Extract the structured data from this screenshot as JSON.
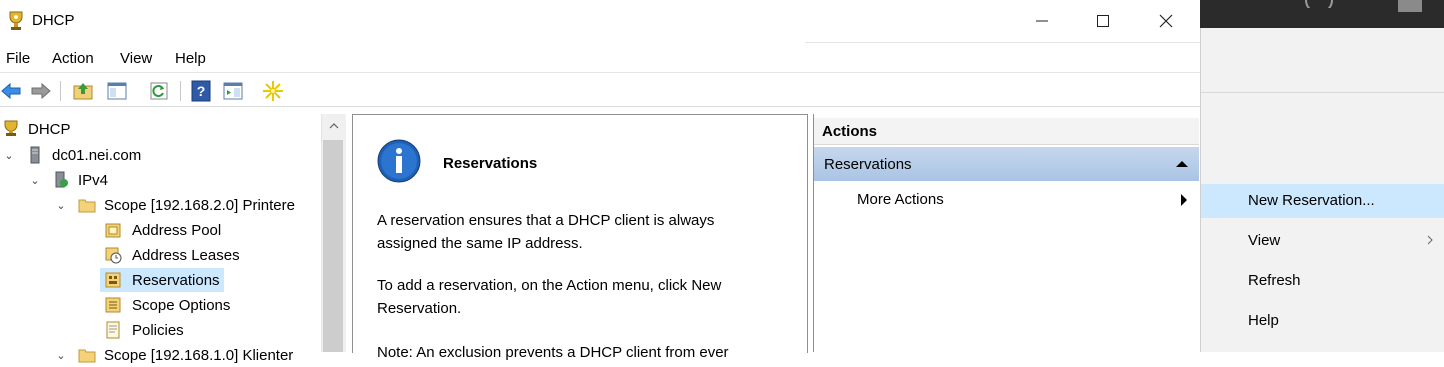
{
  "window": {
    "title": "DHCP",
    "controls": [
      "minimize-button",
      "maximize-button",
      "close-button"
    ]
  },
  "menu": {
    "items": [
      "File",
      "Action",
      "View",
      "Help"
    ]
  },
  "tree": {
    "nodes": [
      {
        "label": "DHCP",
        "icon": "dhcp-trophy-icon",
        "expander": ""
      },
      {
        "label": "dc01.nei.com",
        "icon": "server-icon",
        "expander": "⌄"
      },
      {
        "label": "IPv4",
        "icon": "ipv4-icon",
        "expander": "⌄"
      },
      {
        "label": "Scope [192.168.2.0] Printere",
        "icon": "folder-icon",
        "expander": "⌄"
      },
      {
        "label": "Address Pool",
        "icon": "address-pool-icon",
        "expander": ""
      },
      {
        "label": "Address Leases",
        "icon": "address-leases-icon",
        "expander": ""
      },
      {
        "label": "Reservations",
        "icon": "reservations-icon",
        "expander": "",
        "selected": true
      },
      {
        "label": "Scope Options",
        "icon": "scope-options-icon",
        "expander": ""
      },
      {
        "label": "Policies",
        "icon": "policies-icon",
        "expander": ""
      },
      {
        "label": "Scope [192.168.1.0] Klienter",
        "icon": "folder-icon",
        "expander": "⌄"
      }
    ]
  },
  "center": {
    "heading": "Reservations",
    "para1": "A reservation ensures that a DHCP client is always assigned the same IP address.",
    "para2": "To add a reservation, on the Action menu, click New Reservation.",
    "para3": "Note: An exclusion prevents a DHCP client from ever"
  },
  "actions": {
    "header": "Actions",
    "selected": "Reservations",
    "more": "More Actions"
  },
  "context_menu": {
    "items": [
      {
        "label": "New Reservation...",
        "highlighted": true,
        "submenu": false
      },
      {
        "label": "View",
        "highlighted": false,
        "submenu": true
      },
      {
        "label": "Refresh",
        "highlighted": false,
        "submenu": false
      },
      {
        "label": "Help",
        "highlighted": false,
        "submenu": false
      }
    ]
  },
  "colors": {
    "selection": "#cce8ff",
    "ctx_highlight": "#cce8ff",
    "actions_selected": "#b5cce9"
  }
}
